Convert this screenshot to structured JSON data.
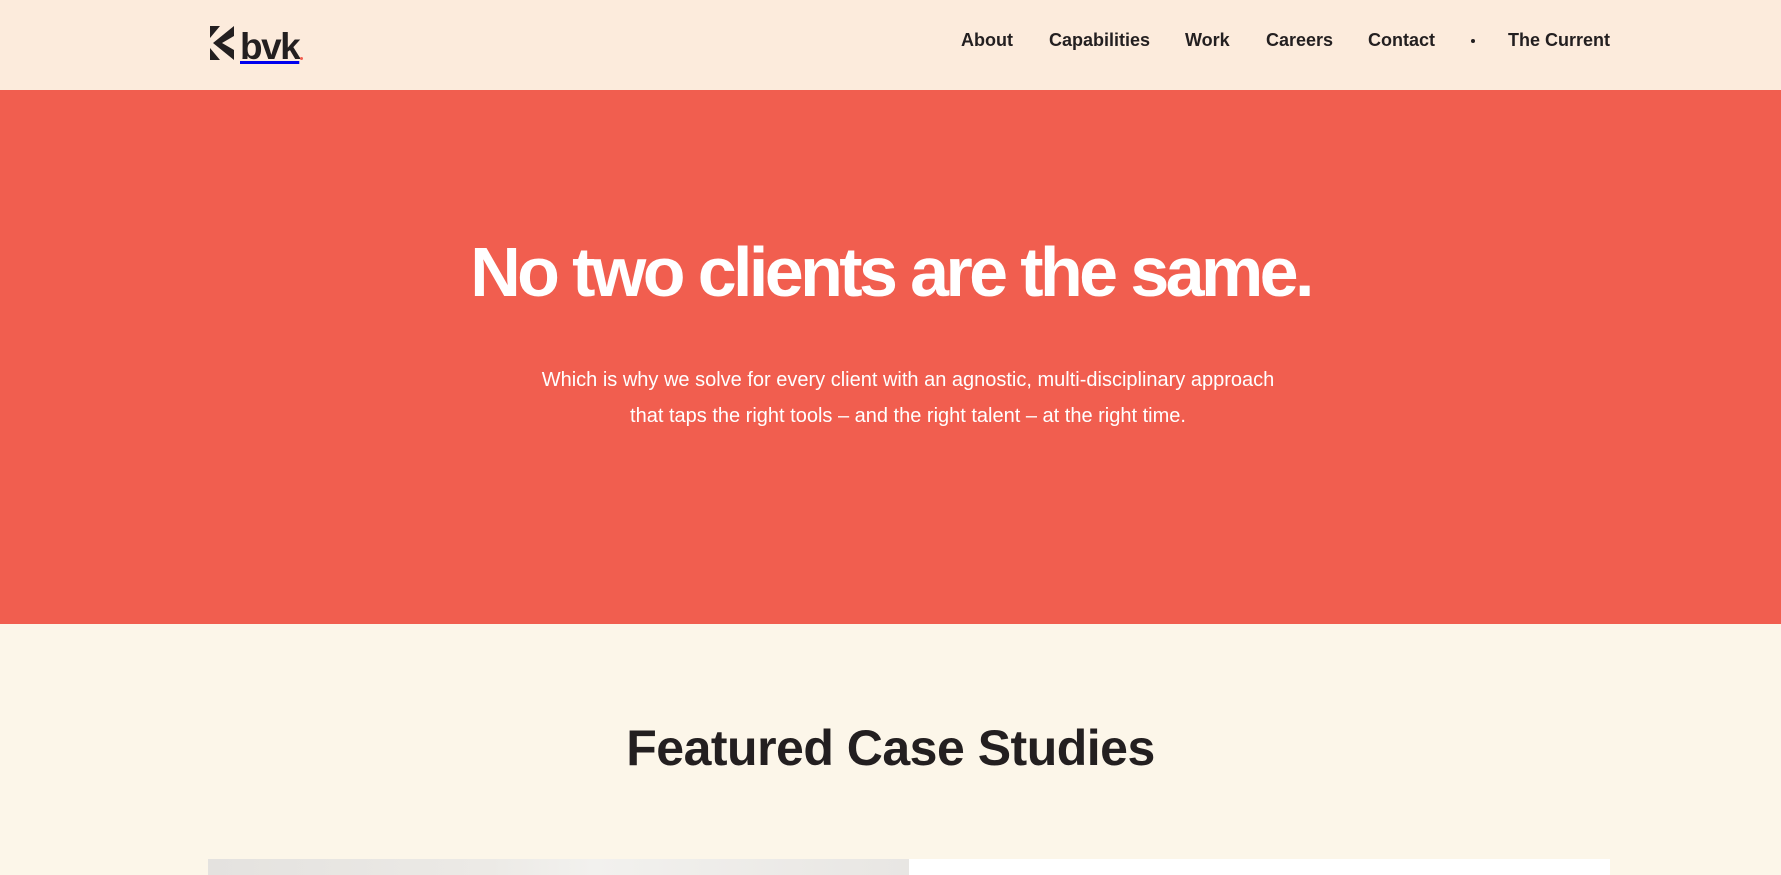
{
  "header": {
    "logo_text": "bvk",
    "nav": {
      "about": "About",
      "capabilities": "Capabilities",
      "work": "Work",
      "careers": "Careers",
      "contact": "Contact",
      "the_current": "The Current"
    }
  },
  "hero": {
    "title": "No two clients are the same.",
    "subtitle": "Which is why we solve for every client with an agnostic, multi-disciplinary approach that taps the right tools – and the right talent – at the right time."
  },
  "featured": {
    "title": "Featured Case Studies"
  },
  "colors": {
    "header_bg": "#fcebdc",
    "hero_bg": "#f15e4f",
    "page_bg": "#fcf6e9",
    "text_dark": "#231f20",
    "text_light": "#ffffff"
  },
  "icons": {
    "logo_mark": "bvk-chevron-mark",
    "separator": "dot-separator"
  }
}
